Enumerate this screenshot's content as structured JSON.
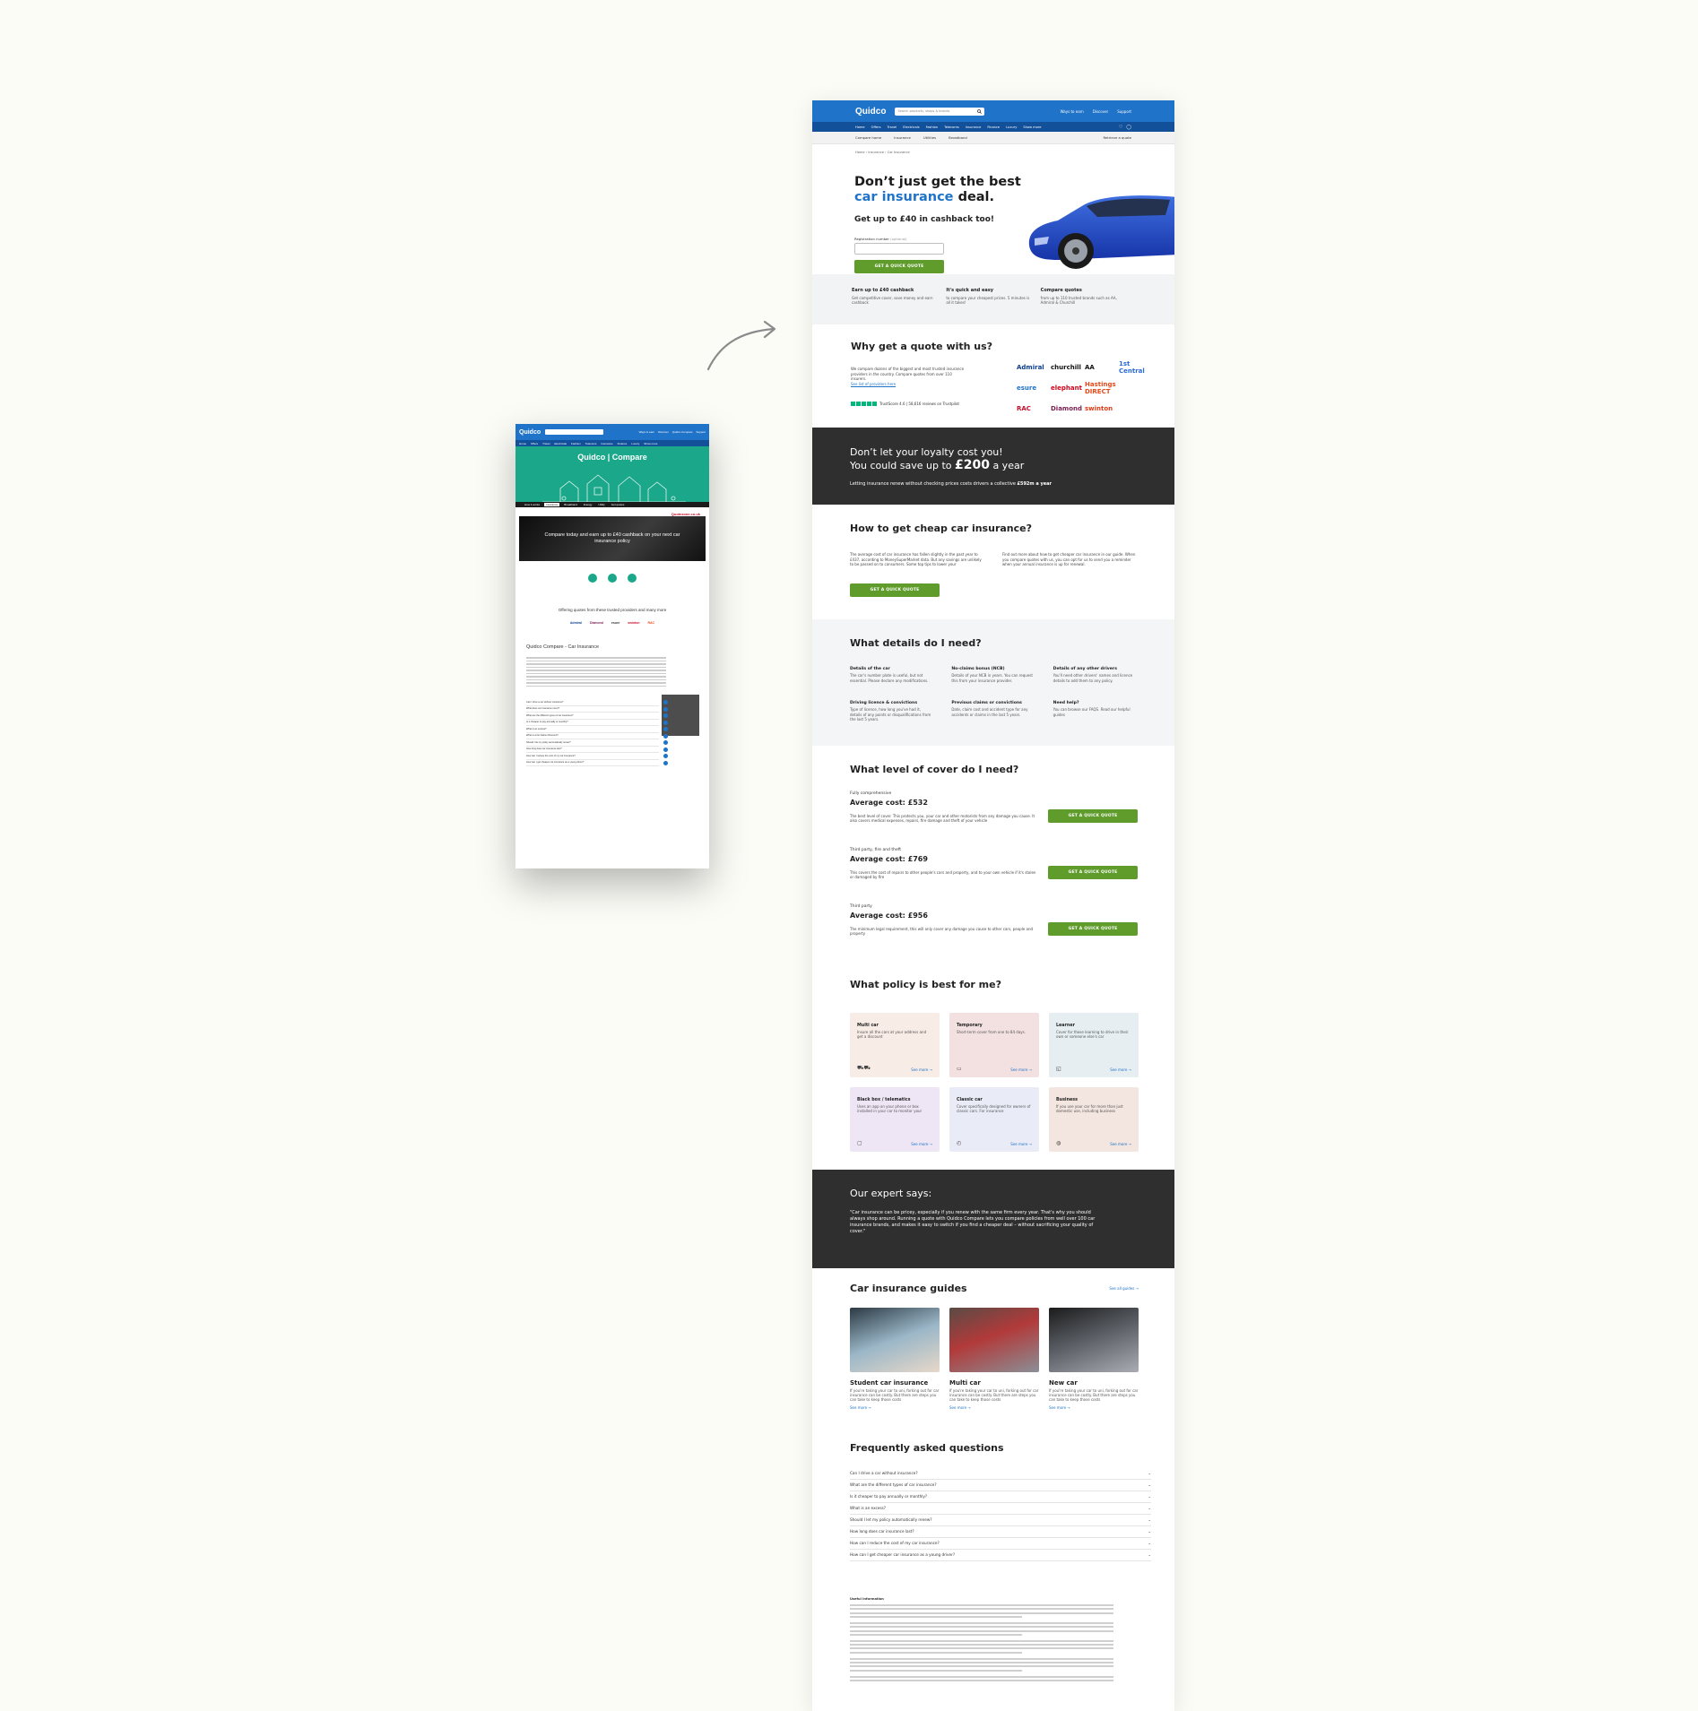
{
  "old_page": {
    "logo": "Quidco",
    "header_links": [
      "Ways to earn",
      "Discover",
      "Quidco Compare",
      "Support"
    ],
    "nav": [
      "Home",
      "Offers",
      "Travel",
      "Electricals",
      "Fashion",
      "Telecoms",
      "Insurance",
      "Finance",
      "Luxury",
      "Show more"
    ],
    "hero_title": "Quidco | Compare",
    "tabs": [
      "How it works",
      "Insurance",
      "Broadband",
      "Energy",
      "Utility",
      "Get quotes"
    ],
    "badge": "Quotezone.co.uk",
    "banner": "Compare today and earn up to £40 cashback on your next car insurance policy",
    "offering": "Offering quotes from these trusted providers and many more",
    "logos": [
      "Admiral",
      "Diamond",
      "esure",
      "swinton",
      "RAC"
    ],
    "section_title": "Quidco Compare - Car Insurance",
    "faq": [
      "Can I drive a car without insurance?",
      "What does car insurance cover?",
      "What are the different types of car insurance?",
      "Is it cheaper to pay annually or monthly?",
      "What is an excess?",
      "What is a No Claims Discount?",
      "Should I let my policy automatically renew?",
      "How long does car insurance last?",
      "How can I reduce the cost of my car insurance?",
      "How can I get cheaper car insurance as a young driver?"
    ]
  },
  "header": {
    "logo": "Quidco",
    "search_placeholder": "Search products, shops & brands",
    "links": [
      "Ways to earn",
      "Discover",
      "Support"
    ]
  },
  "nav": {
    "items": [
      "Home",
      "Offers",
      "Travel",
      "Electricals",
      "Fashion",
      "Telecoms",
      "Insurance",
      "Finance",
      "Luxury",
      "Show more"
    ]
  },
  "subnav": {
    "items": [
      "Compare home",
      "Insurance",
      "Utilities",
      "Broadband"
    ],
    "retrieve": "Retrieve a quote"
  },
  "breadcrumb": "Home  ›  Insurance  ›  Car Insurance",
  "hero": {
    "title_a": "Don’t just get the best",
    "title_b": "car insurance",
    "title_c": " deal.",
    "subtitle": "Get up to £40 in cashback too!",
    "reg_label": "Registration number",
    "reg_optional": " (optional)",
    "cta": "GET A QUICK QUOTE"
  },
  "usps": [
    {
      "title": "Earn up to £40 cashback",
      "text": "Get competitive cover, save money and earn cashback"
    },
    {
      "title": "It's quick and easy",
      "text": "to compare your cheapest prices. 5 minutes is all it takes!"
    },
    {
      "title": "Compare quotes",
      "text": "from up to 110 trusted brands such as AA, Admiral & Churchill"
    }
  ],
  "why": {
    "title": "Why get a quote with us?",
    "text": "We compare dozens of the biggest and most trusted insurance providers in the country. Compare quotes from over 110 insurers.",
    "providers_link": "See list of providers here",
    "trustpilot": "TrustScore 4.6  |  58,616 reviews on Trustpilot",
    "providers": [
      "Admiral",
      "churchill",
      "AA",
      "1st Central",
      "esure",
      "elephant",
      "Hastings DIRECT",
      "",
      "RAC",
      "Diamond",
      "swinton",
      ""
    ]
  },
  "loyalty": {
    "line1": "Don’t let your loyalty cost you!",
    "line2a": "You could save up to ",
    "amount": "£200",
    "line2b": " a year",
    "text": "Letting insurance renew without checking prices costs drivers a collective ",
    "text_b": "£592m a year"
  },
  "cheap": {
    "title": "How to get cheap car insurance?",
    "left": "The average cost of car insurance has fallen slightly in the past year to £437, according to MoneySuperMarket data. But any savings are unlikely to be passed on to consumers. Some top tips to lower your",
    "right": "Find out more about how to get cheaper car insurance in our guide. When you compare quotes with us, you can opt for us to send you a reminder when your annual insurance is up for renewal.",
    "cta": "GET A QUICK QUOTE"
  },
  "details": {
    "title": "What details do I need?",
    "items": [
      {
        "title": "Details of the car",
        "text": "The car's number plate is useful, but not essential. Please declare any modifications."
      },
      {
        "title": "No-claims bonus (NCB)",
        "text": "Details of your NCB in years. You can request this from your insurance provider."
      },
      {
        "title": "Details of any other drivers",
        "text": "You'll need other drivers' names and licence details to add them to any policy."
      },
      {
        "title": "Driving licence & convictions",
        "text": "Type of licence, how long you've had it, details of any points or disqualifications from the last 5 years."
      },
      {
        "title": "Previous claims or convictions",
        "text": "Date, claim cost and accident type for any accidents or claims in the last 5 years."
      },
      {
        "title": "Need help?",
        "text": "You can browse our FAQS. Read our helpful guides"
      }
    ]
  },
  "levels": {
    "title": "What level of cover do I need?",
    "items": [
      {
        "kind": "Fully comprehensive",
        "cost": "Average cost: £532",
        "text": "The best level of cover. This protects you, your car and other motorists from any damage you cause. It also covers medical expenses, repairs, fire damage and theft of your vehicle",
        "cta": "GET A QUICK QUOTE"
      },
      {
        "kind": "Third party, fire and theft",
        "cost": "Average cost: £769",
        "text": "This covers the cost of repairs to other people's cars and property, and to your own vehicle if it's stolen or damaged by fire",
        "cta": "GET A QUICK QUOTE"
      },
      {
        "kind": "Third party",
        "cost": "Average cost: £956",
        "text": "The minimum legal requirement, this will only cover any damage you cause to other cars, people and property",
        "cta": "GET A QUICK QUOTE"
      }
    ]
  },
  "policies": {
    "title": "What policy is best for me?",
    "see_more": "See more  →",
    "items": [
      {
        "title": "Multi car",
        "text": "Insure all the cars at your address and get a discount",
        "bg": "#f8ece6"
      },
      {
        "title": "Temporary",
        "text": "Short-term cover from one to 84 days.",
        "bg": "#f3e1e1"
      },
      {
        "title": "Learner",
        "text": "Cover for those learning to drive in their own or someone else's car",
        "bg": "#e6eef1"
      },
      {
        "title": "Black box / telematics",
        "text": "Uses an app on your phone or box installed in your car to monitor your",
        "bg": "#eee6f5"
      },
      {
        "title": "Classic car",
        "text": "Cover specifically designed for owners of classic cars. For insurance",
        "bg": "#e9ebf6"
      },
      {
        "title": "Business",
        "text": "If you use your car for more than just domestic use, including business",
        "bg": "#f3e5df"
      }
    ]
  },
  "expert": {
    "title": "Our expert says:",
    "quote": "\"Car insurance can be pricey, especially if you renew with the same firm every year. That's why you should always shop around. Running a quote with Quidco Compare lets you compare policies from well over 100 car insurance brands, and makes it easy to switch if you find a cheaper deal – without sacrificing your quality of cover.\""
  },
  "guides": {
    "title": "Car insurance guides",
    "see_all": "See all guides  →",
    "see_more": "See more  →",
    "items": [
      {
        "title": "Student car insurance",
        "text": "If you're taking your car to uni, forking out for car insurance can be costly. But there are steps you can take to keep those costs"
      },
      {
        "title": "Multi car",
        "text": "If you're taking your car to uni, forking out for car insurance can be costly. But there are steps you can take to keep those costs"
      },
      {
        "title": "New car",
        "text": "If you're taking your car to uni, forking out for car insurance can be costly. But there are steps you can take to keep those costs"
      }
    ]
  },
  "faq": {
    "title": "Frequently asked questions",
    "items": [
      "Can I drive a car without insurance?",
      "What are the different types of car insurance?",
      "Is it cheaper to pay annually or monthly?",
      "What is an excess?",
      "Should I let my policy automatically renew?",
      "How long does car insurance last?",
      "How can I reduce the cost of my car insurance?",
      "How can I get cheaper car insurance as a young driver?"
    ]
  },
  "fine_print": {
    "title": "Useful information"
  },
  "colors": {
    "brand_blue": "#1f73c8",
    "nav_blue": "#12509a",
    "cta_green": "#5f9c2b",
    "dark_band": "#2f2f2f",
    "old_teal": "#1ba88a"
  }
}
